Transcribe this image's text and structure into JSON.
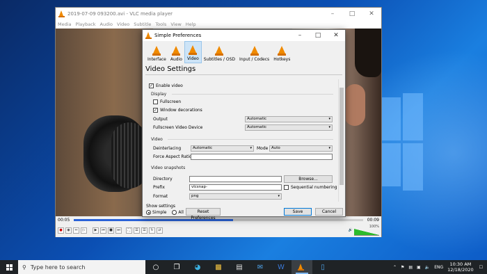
{
  "vlc": {
    "title": "2019-07-09 093200.avi - VLC media player",
    "menu": [
      "Media",
      "Playback",
      "Audio",
      "Video",
      "Subtitle",
      "Tools",
      "View",
      "Help"
    ],
    "time_elapsed": "00:05",
    "time_total": "00:09",
    "seek_progress": 0.55,
    "volume": "100%"
  },
  "prefs": {
    "title": "Simple Preferences",
    "tabs": [
      {
        "label": "Interface",
        "icon": "interface-icon"
      },
      {
        "label": "Audio",
        "icon": "audio-icon"
      },
      {
        "label": "Video",
        "icon": "video-icon",
        "active": true
      },
      {
        "label": "Subtitles / OSD",
        "icon": "subtitles-icon"
      },
      {
        "label": "Input / Codecs",
        "icon": "input-codecs-icon"
      },
      {
        "label": "Hotkeys",
        "icon": "hotkeys-icon"
      }
    ],
    "heading": "Video Settings",
    "enable_video": "Enable video",
    "display": {
      "title": "Display",
      "fullscreen": "Fullscreen",
      "window_decorations": "Window decorations",
      "output_label": "Output",
      "output_value": "Automatic",
      "fs_device_label": "Fullscreen Video Device",
      "fs_device_value": "Automatic"
    },
    "video": {
      "title": "Video",
      "deinterlacing_label": "Deinterlacing",
      "deinterlacing_value": "Automatic",
      "mode_label": "Mode",
      "mode_value": "Auto",
      "aspect_label": "Force Aspect Ratio",
      "aspect_value": ""
    },
    "snapshots": {
      "title": "Video snapshots",
      "directory_label": "Directory",
      "directory_value": "",
      "browse": "Browse...",
      "prefix_label": "Prefix",
      "prefix_value": "vlcsnap-",
      "sequential": "Sequential numbering",
      "format_label": "Format",
      "format_value": "png"
    },
    "show_settings": "Show settings",
    "simple": "Simple",
    "all": "All",
    "reset": "Reset Preferences",
    "save": "Save",
    "cancel": "Cancel"
  },
  "taskbar": {
    "search_placeholder": "Type here to search",
    "lang": "ENG",
    "time": "10:30 AM",
    "date": "12/18/2020"
  },
  "colors": {
    "accent": "#0078d7",
    "vlc_orange": "#f08a00",
    "taskbar": "#1f2326"
  }
}
